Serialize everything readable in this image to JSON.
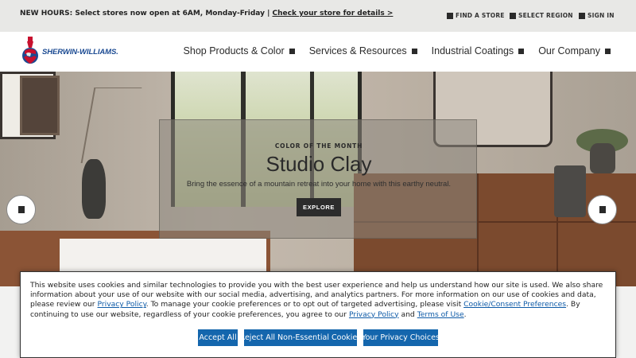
{
  "announcement": {
    "text": "NEW HOURS: Select stores now open at 6AM, Monday-Friday | ",
    "link": "Check your store for details >"
  },
  "utility": {
    "find_store": "FIND A STORE",
    "select_region": "SELECT REGION",
    "sign_in": "SIGN IN"
  },
  "brand": {
    "name": "SHERWIN-WILLIAMS.",
    "color": "#1b4a92"
  },
  "nav": [
    {
      "label": "Shop Products & Color"
    },
    {
      "label": "Services & Resources"
    },
    {
      "label": "Industrial Coatings"
    },
    {
      "label": "Our Company"
    }
  ],
  "hero": {
    "eyebrow": "COLOR OF THE MONTH",
    "title": "Studio Clay",
    "subtitle": "Bring the essence of a mountain retreat into your home with this earthy neutral.",
    "cta": "EXPLORE"
  },
  "cookie": {
    "p1": "This website uses cookies and similar technologies to provide you with the best user experience and help us understand how our site is used. We also share information about your use of our website with our social media, advertising, and analytics partners. For more information on our use of cookies and data, please review our ",
    "privacy_link": "Privacy Policy",
    "p2": ". To manage your cookie preferences or to opt out of targeted advertising, please visit ",
    "consent_link": "Cookie/Consent Preferences",
    "p3": ". By continuing to use our website, regardless of your cookie preferences, you agree to our ",
    "privacy_link2": "Privacy Policy",
    "and": " and ",
    "terms_link": "Terms of Use",
    "end": ".",
    "accept": "Accept All",
    "reject": "Reject All Non-Essential Cookies",
    "choices": "Your Privacy Choices",
    "button_color": "#1466ad"
  }
}
